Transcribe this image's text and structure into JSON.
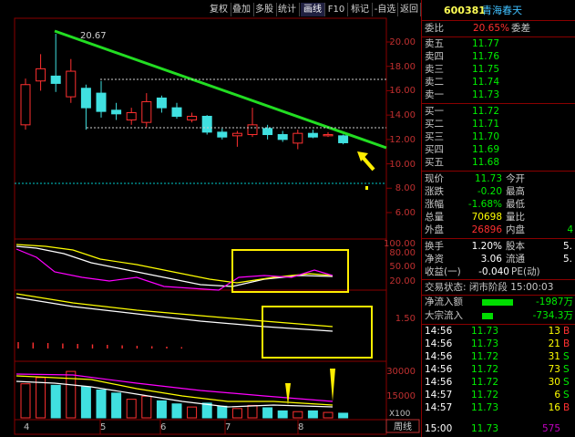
{
  "toolbar": {
    "buttons": [
      "复权",
      "叠加",
      "多股",
      "统计",
      "画线",
      "F10",
      "标记",
      "-自选",
      "返回"
    ],
    "active": "画线",
    "scroll_label": "◂"
  },
  "chart": {
    "high_label": "20.67",
    "price_ticks": [
      "20.00",
      "18.00",
      "16.00",
      "14.00",
      "12.00",
      "10.00",
      "8.00",
      "6.00"
    ],
    "indicator1_ticks": [
      "100.00",
      "80.00",
      "50.00",
      "20.00"
    ],
    "indicator2_ticks": [
      "1.50"
    ],
    "volume_ticks": [
      "30000",
      "15000"
    ],
    "volume_unit": "X100",
    "period": "周线",
    "x_labels": [
      "4",
      "5",
      "6",
      "7",
      "8"
    ],
    "candles": [
      {
        "o": 13.2,
        "c": 16.5,
        "h": 17.0,
        "l": 12.8
      },
      {
        "o": 16.8,
        "c": 17.8,
        "h": 19.0,
        "l": 16.0
      },
      {
        "o": 17.2,
        "c": 16.6,
        "h": 20.67,
        "l": 15.9
      },
      {
        "o": 15.5,
        "c": 17.6,
        "h": 18.6,
        "l": 15.0
      },
      {
        "o": 16.2,
        "c": 14.6,
        "h": 16.5,
        "l": 12.8
      },
      {
        "o": 15.8,
        "c": 14.3,
        "h": 16.8,
        "l": 13.8
      },
      {
        "o": 14.4,
        "c": 14.1,
        "h": 15.0,
        "l": 13.6
      },
      {
        "o": 13.6,
        "c": 14.2,
        "h": 14.6,
        "l": 13.2
      },
      {
        "o": 13.4,
        "c": 15.1,
        "h": 15.8,
        "l": 13.0
      },
      {
        "o": 15.4,
        "c": 14.6,
        "h": 15.6,
        "l": 14.2
      },
      {
        "o": 14.6,
        "c": 13.9,
        "h": 15.0,
        "l": 13.7
      },
      {
        "o": 13.6,
        "c": 13.9,
        "h": 14.2,
        "l": 13.4
      },
      {
        "o": 13.9,
        "c": 12.6,
        "h": 14.0,
        "l": 12.4
      },
      {
        "o": 12.6,
        "c": 12.2,
        "h": 12.9,
        "l": 12.0
      },
      {
        "o": 12.3,
        "c": 12.5,
        "h": 12.7,
        "l": 11.4
      },
      {
        "o": 12.4,
        "c": 13.2,
        "h": 14.6,
        "l": 12.2
      },
      {
        "o": 12.9,
        "c": 12.4,
        "h": 13.2,
        "l": 12.0
      },
      {
        "o": 12.4,
        "c": 12.0,
        "h": 12.7,
        "l": 11.8
      },
      {
        "o": 11.7,
        "c": 12.5,
        "h": 12.8,
        "l": 11.2
      },
      {
        "o": 12.5,
        "c": 12.2,
        "h": 12.8,
        "l": 12.1
      },
      {
        "o": 12.3,
        "c": 12.4,
        "h": 12.6,
        "l": 12.2
      },
      {
        "o": 12.3,
        "c": 11.73,
        "h": 12.4,
        "l": 11.6
      }
    ],
    "volumes": [
      22000,
      26000,
      21000,
      30000,
      20000,
      18000,
      16000,
      12000,
      14000,
      11000,
      9000,
      7000,
      9500,
      7500,
      6000,
      8000,
      6500,
      4500,
      4000,
      4500,
      3500,
      3000
    ]
  },
  "stock": {
    "code": "600381",
    "name": "青海春天"
  },
  "order_ratio": {
    "label": "委比",
    "value": "20.65%",
    "diff_label": "委差"
  },
  "asks": [
    {
      "label": "卖五",
      "price": "11.77"
    },
    {
      "label": "卖四",
      "price": "11.76"
    },
    {
      "label": "卖三",
      "price": "11.75"
    },
    {
      "label": "卖二",
      "price": "11.74"
    },
    {
      "label": "卖一",
      "price": "11.73"
    }
  ],
  "bids": [
    {
      "label": "买一",
      "price": "11.72"
    },
    {
      "label": "买二",
      "price": "11.71"
    },
    {
      "label": "买三",
      "price": "11.70"
    },
    {
      "label": "买四",
      "price": "11.69"
    },
    {
      "label": "买五",
      "price": "11.68"
    }
  ],
  "quote": {
    "now_label": "现价",
    "now": "11.73",
    "open_label": "今开",
    "chg_label": "涨跌",
    "chg": "-0.20",
    "high_label": "最高",
    "pct_label": "涨幅",
    "pct": "-1.68%",
    "low_label": "最低",
    "vol_label": "总量",
    "vol": "70698",
    "ratio_label": "量比",
    "outer_label": "外盘",
    "outer": "26896",
    "inner_label": "内盘",
    "inner": "4"
  },
  "stats": {
    "turnover_label": "换手",
    "turnover": "1.20%",
    "share_label": "股本",
    "share": "5.",
    "nav_label": "净资",
    "nav": "3.06",
    "float_label": "流通",
    "float": "5.",
    "eps_label": "收益(一)",
    "eps": "-0.040",
    "pe_label": "PE(动)"
  },
  "status": {
    "label": "交易状态: 闭市阶段 15:00:03"
  },
  "flow": [
    {
      "label": "净流入额",
      "value": "-1987万"
    },
    {
      "label": "大宗流入",
      "value": "-734.3万"
    }
  ],
  "ticks": [
    {
      "time": "14:56",
      "price": "11.73",
      "vol": "13",
      "side": "B"
    },
    {
      "time": "14:56",
      "price": "11.73",
      "vol": "21",
      "side": "B"
    },
    {
      "time": "14:56",
      "price": "11.72",
      "vol": "31",
      "side": "S"
    },
    {
      "time": "14:56",
      "price": "11.72",
      "vol": "73",
      "side": "S"
    },
    {
      "time": "14:56",
      "price": "11.72",
      "vol": "30",
      "side": "S"
    },
    {
      "time": "14:57",
      "price": "11.72",
      "vol": "6",
      "side": "S"
    },
    {
      "time": "14:57",
      "price": "11.73",
      "vol": "16",
      "side": "B"
    },
    {
      "time": "15:00",
      "price": "11.73",
      "vol": "575",
      "side": ""
    }
  ]
}
